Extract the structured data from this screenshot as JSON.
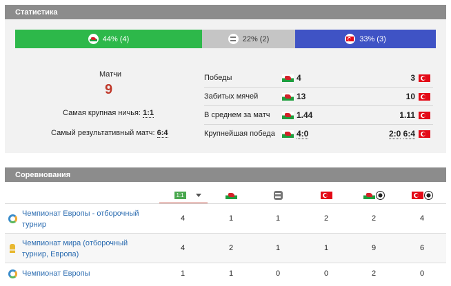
{
  "stats": {
    "title": "Статистика",
    "bars": {
      "wales": {
        "label": "44% (4)",
        "percent": 44,
        "color": "#2db84a"
      },
      "draw": {
        "label": "22% (2)",
        "percent": 22,
        "color": "#c5c5c5"
      },
      "turkey": {
        "label": "33% (3)",
        "percent": 33,
        "color": "#3f53c5"
      }
    },
    "matches_label": "Матчи",
    "matches_value": "9",
    "largest_draw_label": "Самая крупная ничья:",
    "largest_draw_value": "1:1",
    "most_productive_label": "Самый результативный матч:",
    "most_productive_value": "6:4",
    "rows": [
      {
        "name": "Победы",
        "left": "4",
        "right": "3"
      },
      {
        "name": "Забитых мячей",
        "left": "13",
        "right": "10"
      },
      {
        "name": "В среднем за матч",
        "left": "1.44",
        "right": "1.11"
      },
      {
        "name": "Крупнейшая победа",
        "left": "4:0",
        "right_a": "2:0",
        "right_b": "6:4"
      }
    ]
  },
  "competitions": {
    "title": "Соревнования",
    "score_icon_text": "1:1",
    "rows": [
      {
        "name": "Чемпионат Европы - отборочный турнир",
        "icon": "euro-icon",
        "values": [
          "4",
          "1",
          "1",
          "2",
          "2",
          "4"
        ]
      },
      {
        "name": "Чемпионат мира (отборочный турнир, Европа)",
        "icon": "world-cup-icon",
        "values": [
          "4",
          "2",
          "1",
          "1",
          "9",
          "6"
        ]
      },
      {
        "name": "Чемпионат Европы",
        "icon": "euro-icon",
        "values": [
          "1",
          "1",
          "0",
          "0",
          "2",
          "0"
        ]
      }
    ]
  },
  "colors": {
    "header": "#8c8c8c",
    "link": "#2a6bb0",
    "accent": "#c0392b"
  }
}
